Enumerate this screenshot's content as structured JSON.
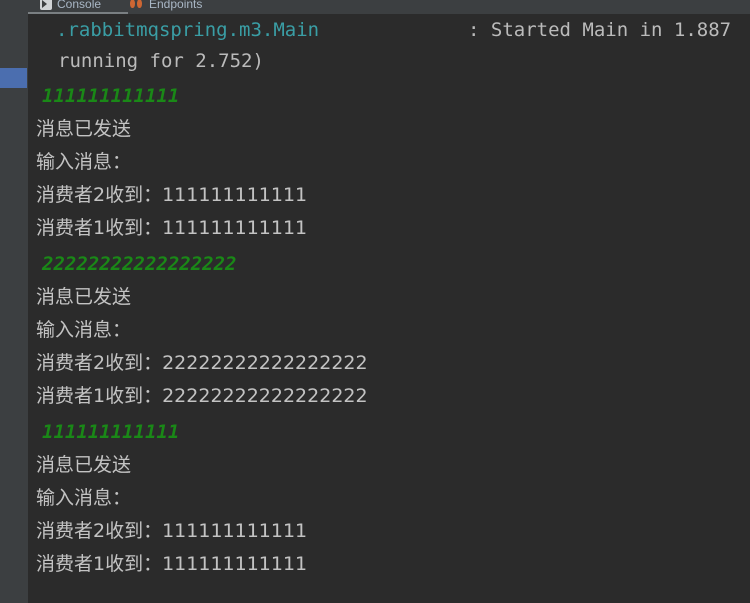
{
  "window": {
    "background": "#2b2b2b",
    "gutter_background": "#3c3f41",
    "marker_color": "#4b6eaf"
  },
  "tabs": [
    {
      "label": "Console",
      "icon": "console-play-icon",
      "active": true
    },
    {
      "label": "Endpoints",
      "icon": "endpoints-icon",
      "active": false
    }
  ],
  "console": {
    "lines": [
      {
        "kind": "log",
        "indent": 2,
        "text": ".rabbitmqspring.m3.Main"
      },
      {
        "kind": "log",
        "indent": 0,
        "text": ""
      },
      {
        "kind": "info",
        "indent": 0,
        "text": ": Started Main in 1.887"
      },
      {
        "kind": "info",
        "indent": 3,
        "text": "running for 2.752)"
      },
      {
        "kind": "green",
        "indent": 2,
        "text": "111111111111"
      },
      {
        "kind": "cn",
        "indent": 1,
        "text": "消息已发送"
      },
      {
        "kind": "cn",
        "indent": 1,
        "text": "输入消息："
      },
      {
        "kind": "cn",
        "indent": 1,
        "text": "消费者2收到：111111111111"
      },
      {
        "kind": "cn",
        "indent": 1,
        "text": "消费者1收到：111111111111"
      },
      {
        "kind": "green",
        "indent": 2,
        "text": "22222222222222222"
      },
      {
        "kind": "cn",
        "indent": 1,
        "text": "消息已发送"
      },
      {
        "kind": "cn",
        "indent": 1,
        "text": "输入消息："
      },
      {
        "kind": "cn",
        "indent": 1,
        "text": "消费者2收到：22222222222222222"
      },
      {
        "kind": "cn",
        "indent": 1,
        "text": "消费者1收到：22222222222222222"
      },
      {
        "kind": "green",
        "indent": 2,
        "text": "111111111111"
      },
      {
        "kind": "cn",
        "indent": 1,
        "text": "消息已发送"
      },
      {
        "kind": "cn",
        "indent": 1,
        "text": "输入消息："
      },
      {
        "kind": "cn",
        "indent": 1,
        "text": "消费者2收到：111111111111"
      },
      {
        "kind": "cn",
        "indent": 1,
        "text": "消费者1收到：111111111111"
      }
    ],
    "rendered": {
      "l0_left": ".rabbitmqspring.m3.Main",
      "l0_right": ": Started Main in 1.887",
      "l1": "running for 2.752)",
      "l2": "111111111111",
      "l3": "消息已发送",
      "l4": "输入消息：",
      "l5": "消费者2收到：111111111111",
      "l6": "消费者1收到：111111111111",
      "l7": "22222222222222222",
      "l8": "消息已发送",
      "l9": "输入消息：",
      "l10": "消费者2收到：22222222222222222",
      "l11": "消费者1收到：22222222222222222",
      "l12": "111111111111",
      "l13": "消息已发送",
      "l14": "输入消息：",
      "l15": "消费者2收到：111111111111",
      "l16": "消费者1收到：111111111111"
    }
  }
}
